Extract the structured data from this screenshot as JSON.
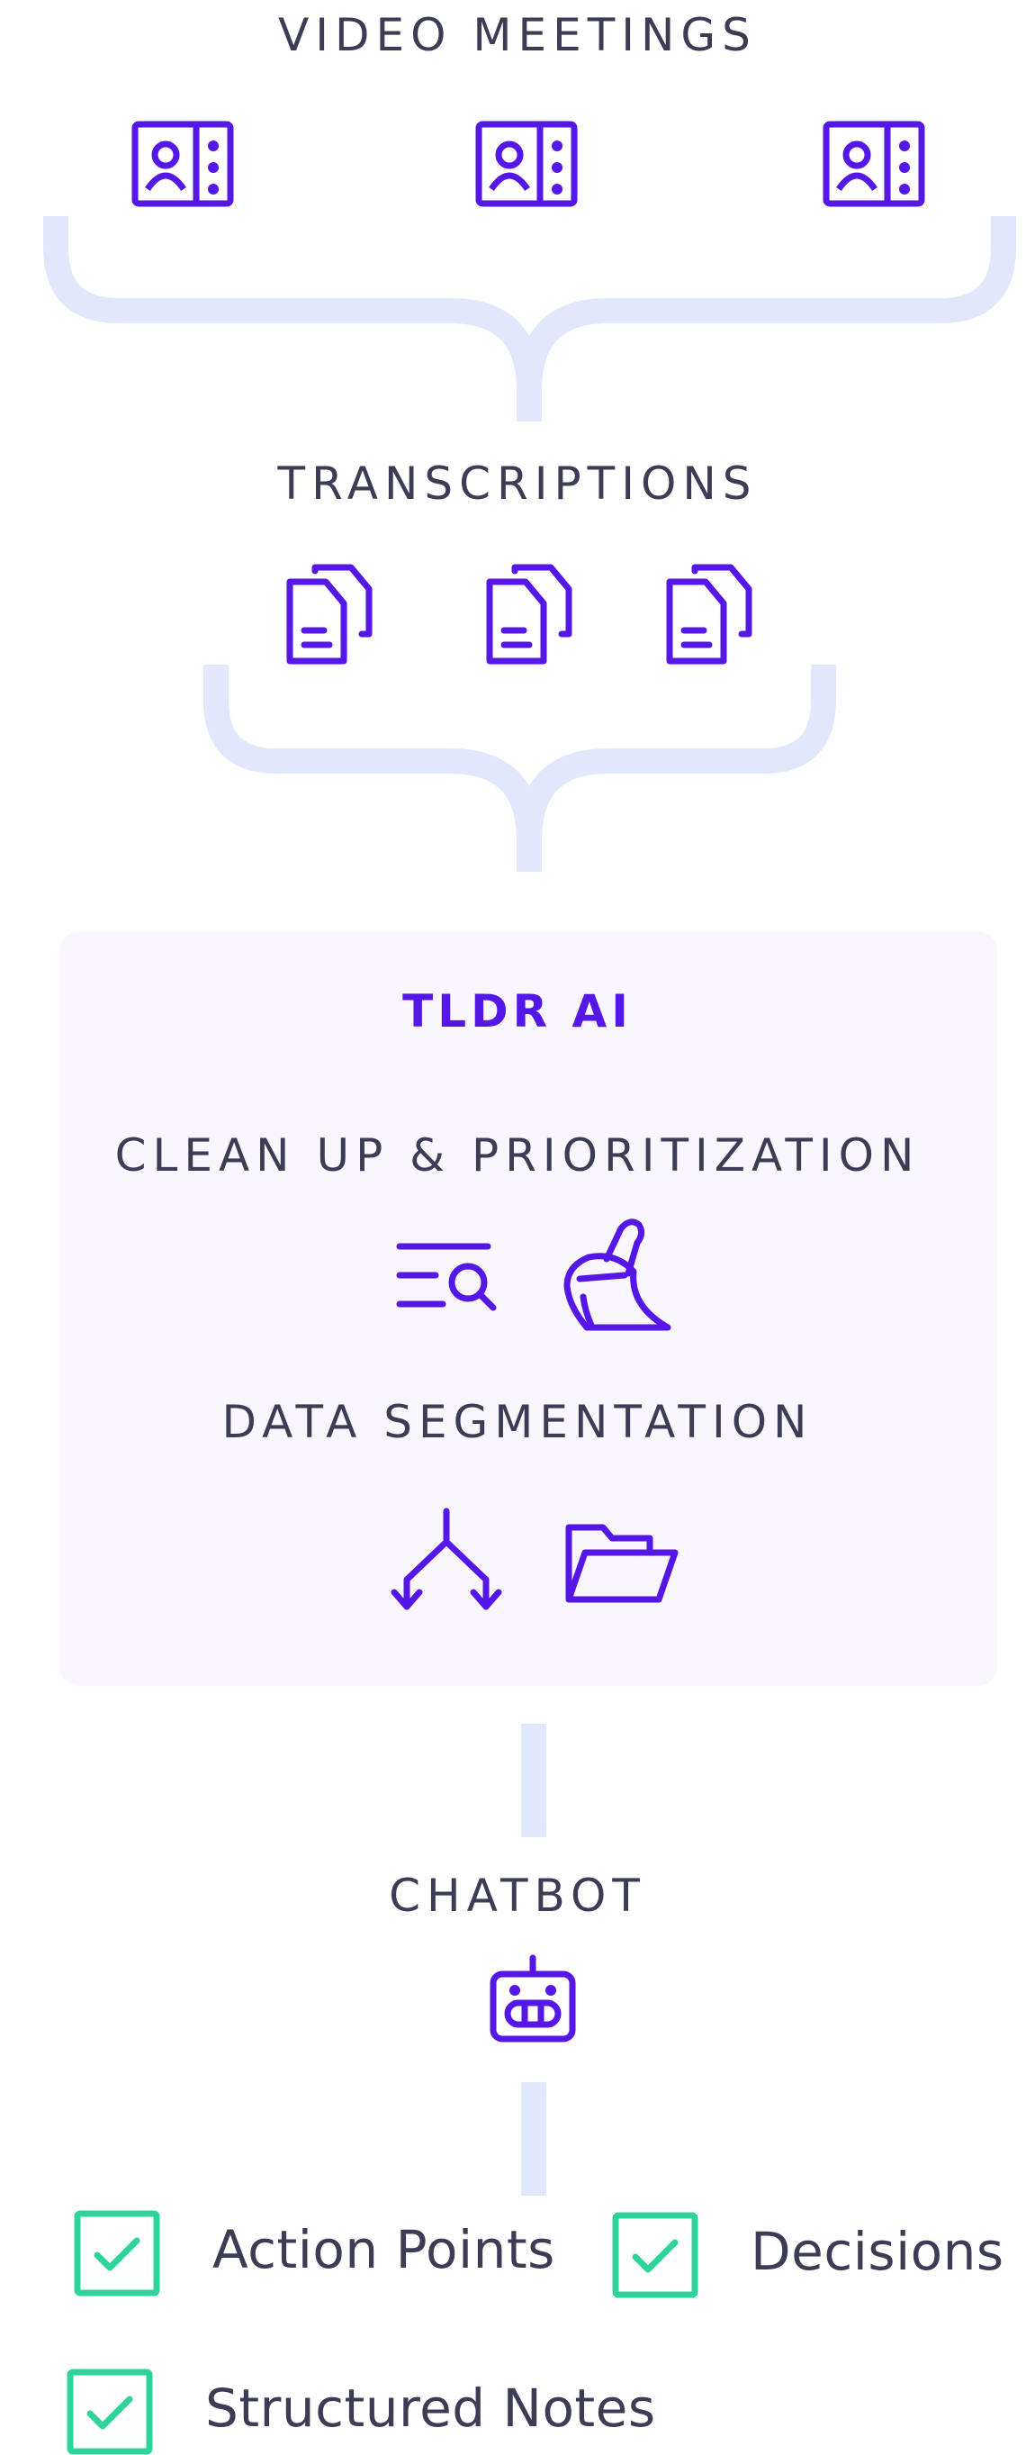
{
  "stages": {
    "video_meetings": {
      "label": "VIDEO MEETINGS"
    },
    "transcriptions": {
      "label": "TRANSCRIPTIONS"
    },
    "tldr": {
      "title": "TLDR AI",
      "clean_up": "CLEAN UP & PRIORITIZATION",
      "segmentation": "DATA SEGMENTATION"
    },
    "chatbot": {
      "label": "CHATBOT"
    }
  },
  "outputs": [
    {
      "label": "Action Points"
    },
    {
      "label": "Decisions"
    },
    {
      "label": "Structured Notes"
    }
  ],
  "colors": {
    "accent": "#5417e6",
    "connector": "#e2e8fb",
    "check": "#2fd39c",
    "text": "#3c3c55",
    "panel": "#f9f6fd"
  }
}
